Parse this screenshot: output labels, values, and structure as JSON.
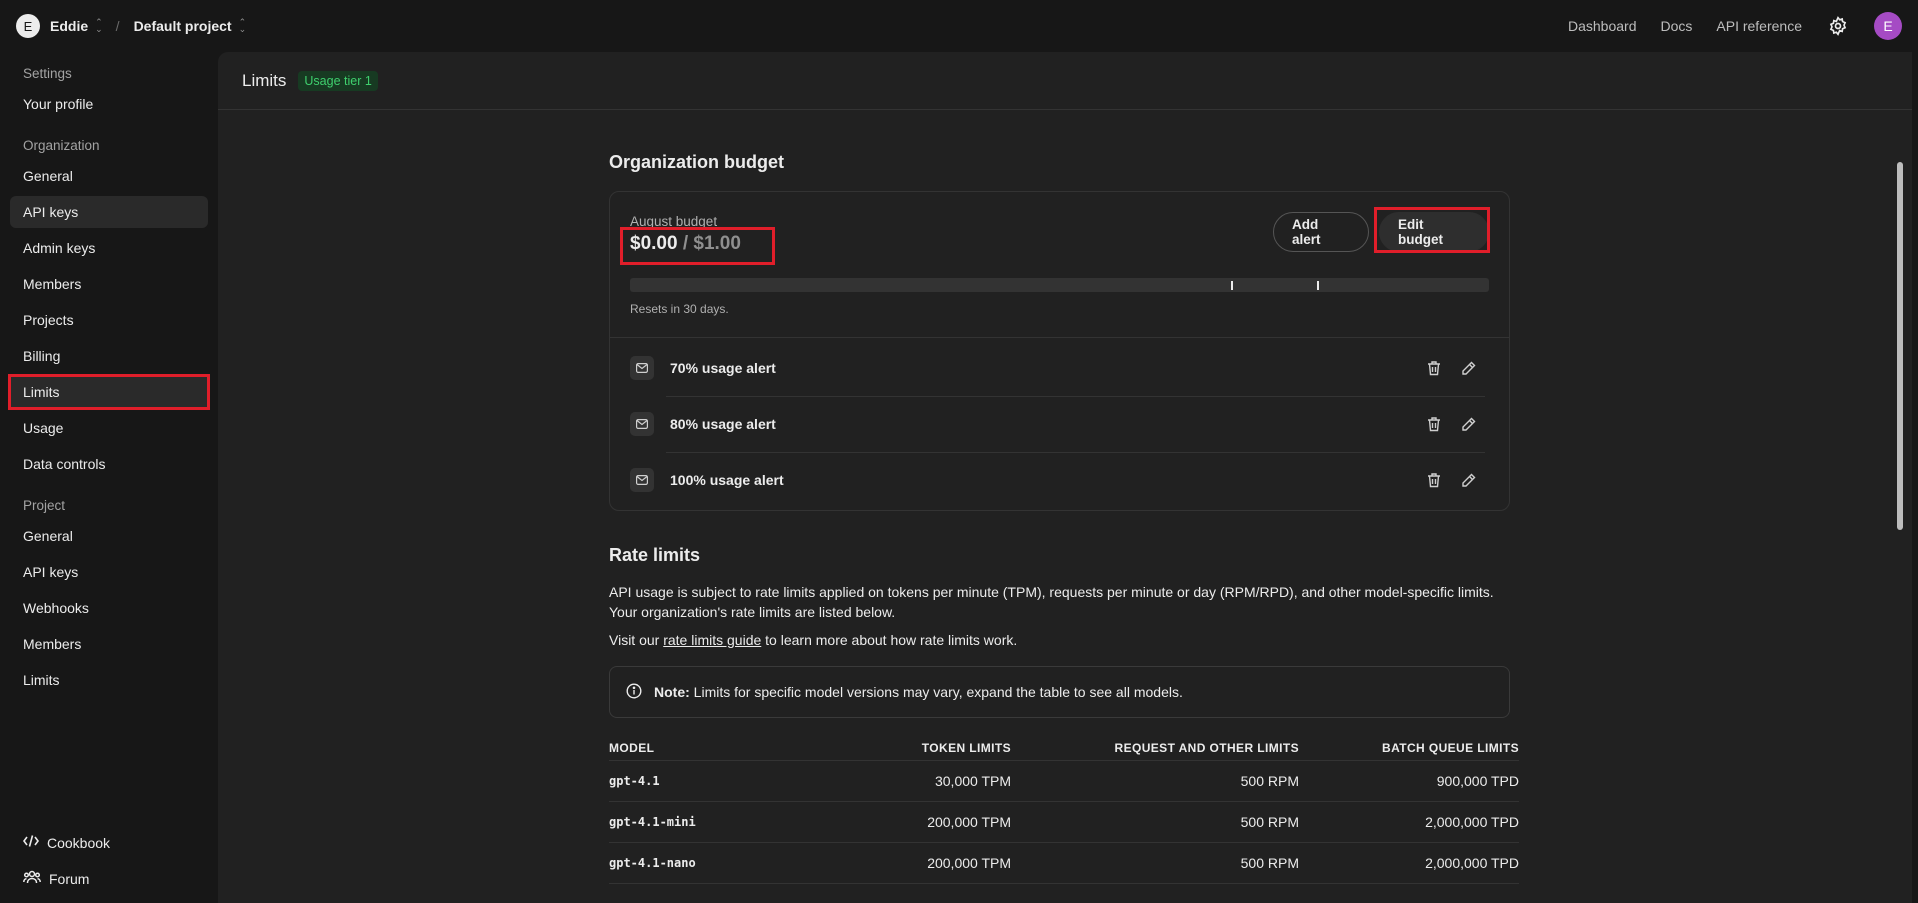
{
  "topbar": {
    "org_initial": "E",
    "org_name": "Eddie",
    "separator": "/",
    "project_name": "Default project",
    "links": [
      "Dashboard",
      "Docs",
      "API reference"
    ],
    "user_initial": "E",
    "user_avatar_color": "#a54bc4"
  },
  "sidebar": {
    "sections": [
      {
        "title": "Settings",
        "items": [
          "Your profile"
        ]
      },
      {
        "title": "Organization",
        "items": [
          "General",
          "API keys",
          "Admin keys",
          "Members",
          "Projects",
          "Billing",
          "Limits",
          "Usage",
          "Data controls"
        ]
      },
      {
        "title": "Project",
        "items": [
          "General",
          "API keys",
          "Webhooks",
          "Members",
          "Limits"
        ]
      }
    ],
    "active_item": "Limits",
    "hover_item": "API keys",
    "bottom": [
      {
        "icon": "code-icon",
        "label": "Cookbook"
      },
      {
        "icon": "people-icon",
        "label": "Forum"
      }
    ]
  },
  "header": {
    "title": "Limits",
    "tier_badge": "Usage tier 1",
    "tier_color": "#3fcf6e"
  },
  "budget": {
    "title": "Organization budget",
    "label": "August budget",
    "spent": "$0.00",
    "separator": "/",
    "total": "$1.00",
    "add_alert_label": "Add alert",
    "edit_budget_label": "Edit budget",
    "progress_fraction": 0.0,
    "alert_thresholds": [
      0.7,
      0.8,
      1.0
    ],
    "resets_text": "Resets in 30 days.",
    "alerts": [
      "70% usage alert",
      "80% usage alert",
      "100% usage alert"
    ]
  },
  "rate_limits": {
    "title": "Rate limits",
    "description": "API usage is subject to rate limits applied on tokens per minute (TPM), requests per minute or day (RPM/RPD), and other model-specific limits. Your organization's rate limits are listed below.",
    "visit_prefix": "Visit our ",
    "visit_link": "rate limits guide",
    "visit_suffix": " to learn more about how rate limits work.",
    "note_label": "Note:",
    "note_text": " Limits for specific model versions may vary, expand the table to see all models.",
    "columns": [
      "MODEL",
      "TOKEN LIMITS",
      "REQUEST AND OTHER LIMITS",
      "BATCH QUEUE LIMITS"
    ],
    "rows": [
      {
        "model": "gpt-4.1",
        "tokens": "30,000 TPM",
        "requests": "500 RPM",
        "batch": "900,000 TPD"
      },
      {
        "model": "gpt-4.1-mini",
        "tokens": "200,000 TPM",
        "requests": "500 RPM",
        "batch": "2,000,000 TPD"
      },
      {
        "model": "gpt-4.1-nano",
        "tokens": "200,000 TPM",
        "requests": "500 RPM",
        "batch": "2,000,000 TPD"
      }
    ]
  }
}
